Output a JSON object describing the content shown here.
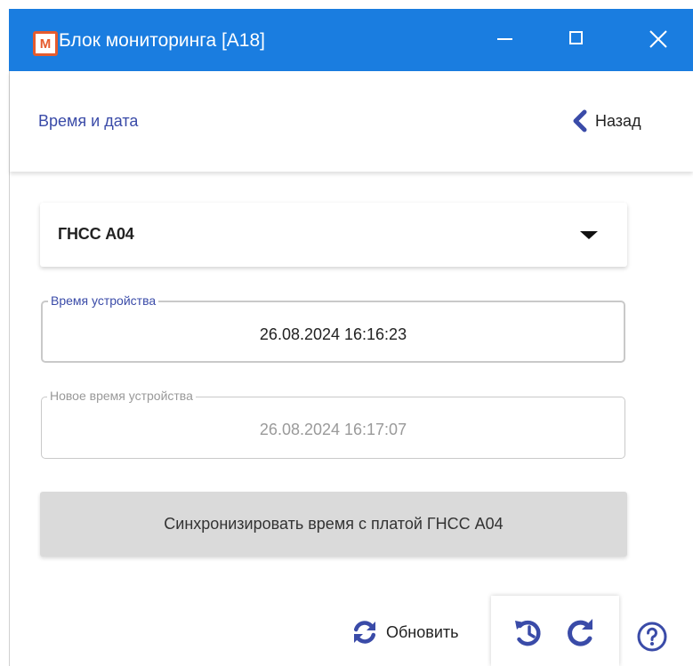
{
  "window": {
    "title": "Блок мониторинга [A18]",
    "logo_letter": "М",
    "accent": "#1a7de0"
  },
  "header": {
    "page_title": "Время и дата",
    "back_label": "Назад"
  },
  "device_select": {
    "selected": "ГНСС А04"
  },
  "device_time": {
    "legend": "Время устройства",
    "value": "26.08.2024 16:16:23"
  },
  "new_device_time": {
    "legend": "Новое время устройства",
    "value": "26.08.2024 16:17:07"
  },
  "sync_button": {
    "label": "Синхронизировать время с платой ГНСС А04"
  },
  "footer": {
    "refresh_label": "Обновить"
  },
  "icons": {
    "back": "chevron-left-icon",
    "refresh": "refresh-icon",
    "undo": "history-icon",
    "redo": "redo-icon",
    "help": "help-icon",
    "icon_color": "#3a4ba8"
  }
}
